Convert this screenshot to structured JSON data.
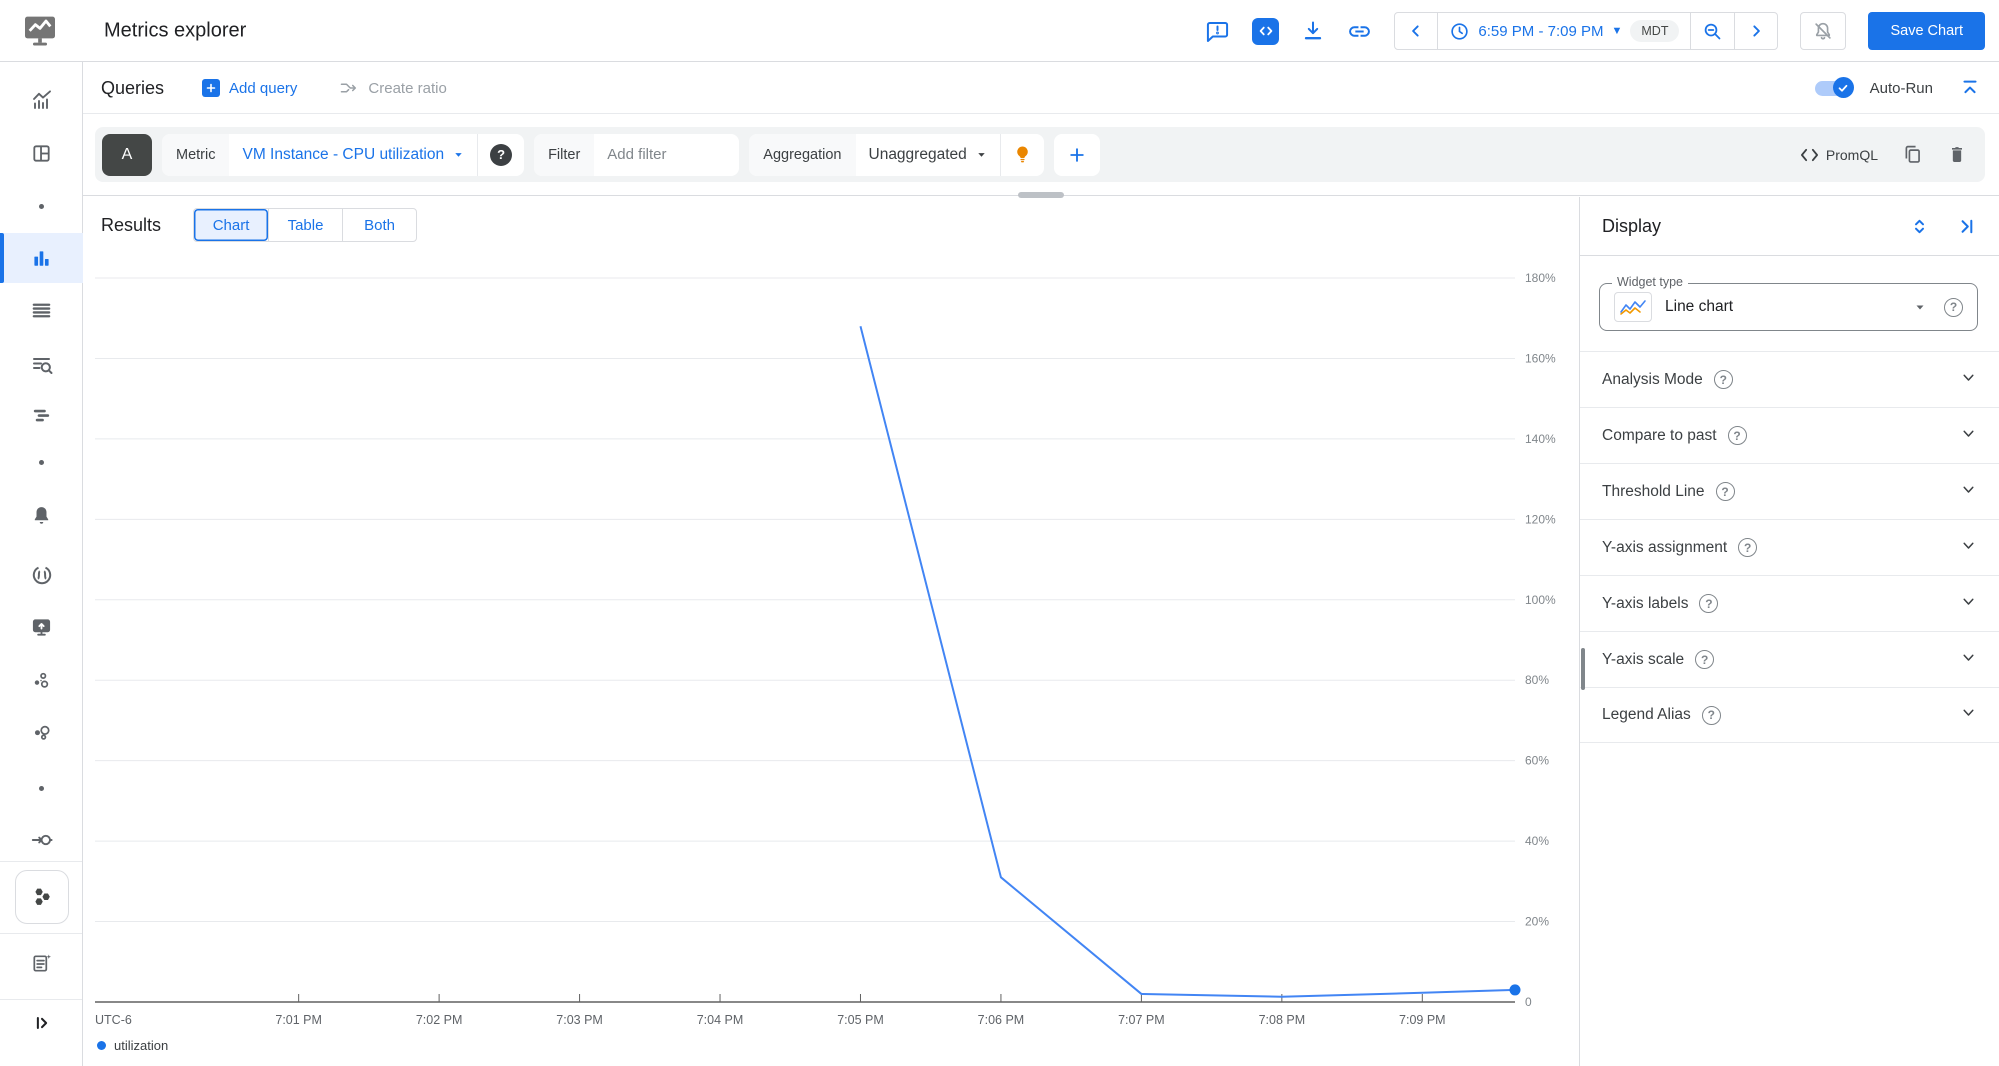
{
  "header": {
    "title": "Metrics explorer",
    "time_range": "6:59 PM - 7:09 PM",
    "timezone": "MDT",
    "save_button": "Save Chart",
    "icons": [
      "feedback-icon",
      "code-toggle-icon",
      "download-icon",
      "link-icon",
      "chevron-left-icon",
      "clock-icon",
      "caret-down-icon",
      "zoom-out-icon",
      "chevron-right-icon",
      "alerts-off-icon"
    ]
  },
  "queries": {
    "title": "Queries",
    "add_query": "Add query",
    "create_ratio": "Create ratio",
    "auto_run_label": "Auto-Run",
    "collapse_icon": "collapse-all-icon",
    "query_letter": "A",
    "metric_label": "Metric",
    "metric_value": "VM Instance - CPU utilization",
    "filter_label": "Filter",
    "filter_placeholder": "Add filter",
    "aggregation_label": "Aggregation",
    "aggregation_value": "Unaggregated",
    "promql_label": "PromQL",
    "row_icons": [
      "help-icon",
      "lightbulb-icon",
      "add-icon",
      "code-icon",
      "copy-icon",
      "delete-icon"
    ]
  },
  "results": {
    "title": "Results",
    "tabs": [
      "Chart",
      "Table",
      "Both"
    ],
    "active_tab": "Chart"
  },
  "display_panel": {
    "title": "Display",
    "header_icons": [
      "unfold-icon",
      "collapse-panel-right-icon"
    ],
    "widget_type_label": "Widget type",
    "widget_type_value": "Line chart",
    "sections": [
      "Analysis Mode",
      "Compare to past",
      "Threshold Line",
      "Y-axis assignment",
      "Y-axis labels",
      "Y-axis scale",
      "Legend Alias"
    ]
  },
  "sidebar": {
    "items": [
      "monitoring-logo",
      "metrics-overview-icon",
      "dashboards-icon",
      "hidden-item-dot",
      "metrics-explorer-icon",
      "log-list-icon",
      "log-search-icon",
      "trace-icon",
      "hidden-item-dot",
      "alerting-bell-icon",
      "slo-icon",
      "uptime-check-icon",
      "groups-icon",
      "integrations-icon",
      "hidden-item-dot",
      "pipeline-icon",
      "gke-hexagons-icon",
      "release-notes-icon",
      "expand-sidebar-icon"
    ],
    "active_item": "metrics-explorer-icon"
  },
  "chart_data": {
    "type": "line",
    "title": "VM Instance - CPU utilization",
    "x_axis_note": "UTC-6",
    "x_domain": [
      -1.45,
      8.66
    ],
    "y_domain": [
      0,
      182
    ],
    "grid": "horizontal-only",
    "legend_position": "bottom-left",
    "x_ticks": [
      {
        "value": 0,
        "label": "7:01 PM"
      },
      {
        "value": 1,
        "label": "7:02 PM"
      },
      {
        "value": 2,
        "label": "7:03 PM"
      },
      {
        "value": 3,
        "label": "7:04 PM"
      },
      {
        "value": 4,
        "label": "7:05 PM"
      },
      {
        "value": 5,
        "label": "7:06 PM"
      },
      {
        "value": 6,
        "label": "7:07 PM"
      },
      {
        "value": 7,
        "label": "7:08 PM"
      },
      {
        "value": 8,
        "label": "7:09 PM"
      }
    ],
    "y_ticks": [
      {
        "value": 180,
        "label": "180%"
      },
      {
        "value": 160,
        "label": "160%"
      },
      {
        "value": 140,
        "label": "140%"
      },
      {
        "value": 120,
        "label": "120%"
      },
      {
        "value": 100,
        "label": "100%"
      },
      {
        "value": 80,
        "label": "80%"
      },
      {
        "value": 60,
        "label": "60%"
      },
      {
        "value": 40,
        "label": "40%"
      },
      {
        "value": 20,
        "label": "20%"
      },
      {
        "value": 0,
        "label": "0"
      }
    ],
    "series": [
      {
        "name": "utilization",
        "color": "#4285f4",
        "endpoint_color": "#1a73e8",
        "points_x_minutes_after_7_01_pm_y_percent": [
          [
            4,
            168
          ],
          [
            5,
            31
          ],
          [
            6,
            2
          ],
          [
            7,
            1.3
          ],
          [
            8,
            2.3
          ],
          [
            8.66,
            3
          ]
        ]
      }
    ],
    "legend": [
      {
        "label": "utilization",
        "color": "#1a73e8"
      }
    ]
  },
  "colors": {
    "accent": "#1a73e8",
    "chart_line": "#4285f4",
    "bulb": "#ea8600"
  }
}
